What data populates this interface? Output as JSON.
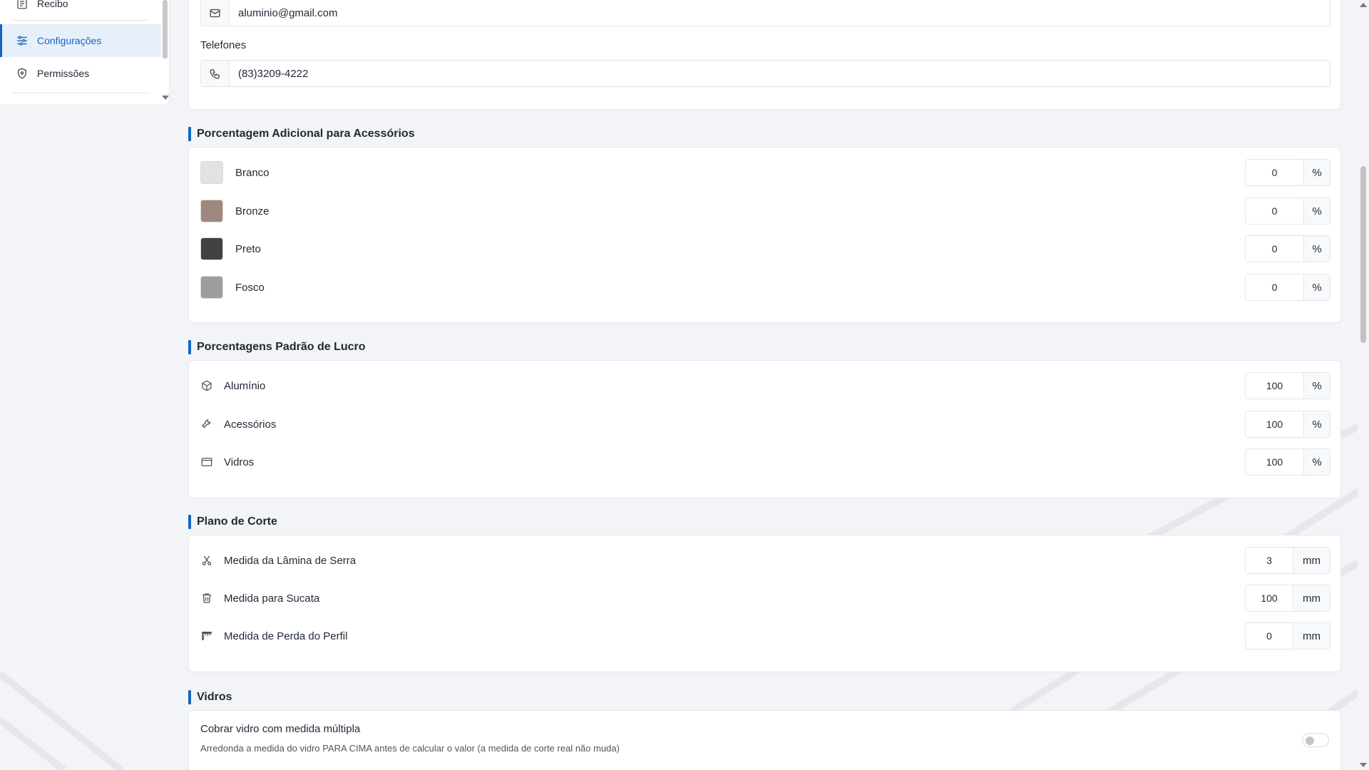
{
  "sidebar": {
    "items": [
      {
        "label": "Recibo",
        "icon": "receipt-icon"
      },
      {
        "label": "Configurações",
        "icon": "sliders-icon",
        "active": true
      },
      {
        "label": "Permissões",
        "icon": "shield-icon"
      }
    ]
  },
  "contact": {
    "email_value": "aluminio@gmail.com",
    "phones_label": "Telefones",
    "phone_value": "(83)3209-4222"
  },
  "accessories_extra": {
    "title": "Porcentagem Adicional para Acessórios",
    "items": [
      {
        "label": "Branco",
        "color": "#e2e2e2",
        "value": "0",
        "unit": "%"
      },
      {
        "label": "Bronze",
        "color": "#a1887f",
        "value": "0",
        "unit": "%"
      },
      {
        "label": "Preto",
        "color": "#424242",
        "value": "0",
        "unit": "%"
      },
      {
        "label": "Fosco",
        "color": "#9e9e9e",
        "value": "0",
        "unit": "%"
      }
    ]
  },
  "profit_defaults": {
    "title": "Porcentagens Padrão de Lucro",
    "items": [
      {
        "label": "Alumínio",
        "icon": "cube-icon",
        "value": "100",
        "unit": "%"
      },
      {
        "label": "Acessórios",
        "icon": "wrench-icon",
        "value": "100",
        "unit": "%"
      },
      {
        "label": "Vidros",
        "icon": "window-icon",
        "value": "100",
        "unit": "%"
      }
    ]
  },
  "cutting_plan": {
    "title": "Plano de Corte",
    "items": [
      {
        "label": "Medida da Lâmina de Serra",
        "icon": "scissors-icon",
        "value": "3",
        "unit": "mm"
      },
      {
        "label": "Medida para Sucata",
        "icon": "trash-icon",
        "value": "100",
        "unit": "mm"
      },
      {
        "label": "Medida de Perda do Perfil",
        "icon": "ruler-icon",
        "value": "0",
        "unit": "mm"
      }
    ]
  },
  "glass": {
    "title": "Vidros",
    "option_label": "Cobrar vidro com medida múltipla",
    "option_desc": "Arredonda a medida do vidro PARA CIMA antes de calcular o valor (a medida de corte real não muda)",
    "option_enabled": false
  },
  "colors": {
    "accent": "#1565c0",
    "active_bg": "#e7f0fa"
  }
}
